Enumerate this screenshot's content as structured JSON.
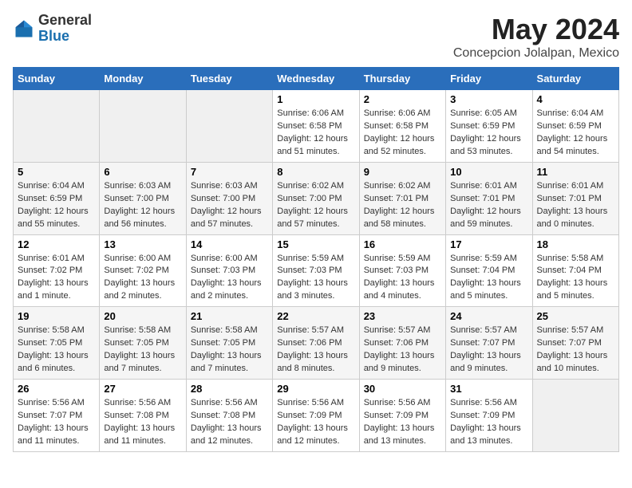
{
  "logo": {
    "general": "General",
    "blue": "Blue"
  },
  "title": "May 2024",
  "subtitle": "Concepcion Jolalpan, Mexico",
  "days_of_week": [
    "Sunday",
    "Monday",
    "Tuesday",
    "Wednesday",
    "Thursday",
    "Friday",
    "Saturday"
  ],
  "weeks": [
    [
      {
        "day": "",
        "info": ""
      },
      {
        "day": "",
        "info": ""
      },
      {
        "day": "",
        "info": ""
      },
      {
        "day": "1",
        "info": "Sunrise: 6:06 AM\nSunset: 6:58 PM\nDaylight: 12 hours\nand 51 minutes."
      },
      {
        "day": "2",
        "info": "Sunrise: 6:06 AM\nSunset: 6:58 PM\nDaylight: 12 hours\nand 52 minutes."
      },
      {
        "day": "3",
        "info": "Sunrise: 6:05 AM\nSunset: 6:59 PM\nDaylight: 12 hours\nand 53 minutes."
      },
      {
        "day": "4",
        "info": "Sunrise: 6:04 AM\nSunset: 6:59 PM\nDaylight: 12 hours\nand 54 minutes."
      }
    ],
    [
      {
        "day": "5",
        "info": "Sunrise: 6:04 AM\nSunset: 6:59 PM\nDaylight: 12 hours\nand 55 minutes."
      },
      {
        "day": "6",
        "info": "Sunrise: 6:03 AM\nSunset: 7:00 PM\nDaylight: 12 hours\nand 56 minutes."
      },
      {
        "day": "7",
        "info": "Sunrise: 6:03 AM\nSunset: 7:00 PM\nDaylight: 12 hours\nand 57 minutes."
      },
      {
        "day": "8",
        "info": "Sunrise: 6:02 AM\nSunset: 7:00 PM\nDaylight: 12 hours\nand 57 minutes."
      },
      {
        "day": "9",
        "info": "Sunrise: 6:02 AM\nSunset: 7:01 PM\nDaylight: 12 hours\nand 58 minutes."
      },
      {
        "day": "10",
        "info": "Sunrise: 6:01 AM\nSunset: 7:01 PM\nDaylight: 12 hours\nand 59 minutes."
      },
      {
        "day": "11",
        "info": "Sunrise: 6:01 AM\nSunset: 7:01 PM\nDaylight: 13 hours\nand 0 minutes."
      }
    ],
    [
      {
        "day": "12",
        "info": "Sunrise: 6:01 AM\nSunset: 7:02 PM\nDaylight: 13 hours\nand 1 minute."
      },
      {
        "day": "13",
        "info": "Sunrise: 6:00 AM\nSunset: 7:02 PM\nDaylight: 13 hours\nand 2 minutes."
      },
      {
        "day": "14",
        "info": "Sunrise: 6:00 AM\nSunset: 7:03 PM\nDaylight: 13 hours\nand 2 minutes."
      },
      {
        "day": "15",
        "info": "Sunrise: 5:59 AM\nSunset: 7:03 PM\nDaylight: 13 hours\nand 3 minutes."
      },
      {
        "day": "16",
        "info": "Sunrise: 5:59 AM\nSunset: 7:03 PM\nDaylight: 13 hours\nand 4 minutes."
      },
      {
        "day": "17",
        "info": "Sunrise: 5:59 AM\nSunset: 7:04 PM\nDaylight: 13 hours\nand 5 minutes."
      },
      {
        "day": "18",
        "info": "Sunrise: 5:58 AM\nSunset: 7:04 PM\nDaylight: 13 hours\nand 5 minutes."
      }
    ],
    [
      {
        "day": "19",
        "info": "Sunrise: 5:58 AM\nSunset: 7:05 PM\nDaylight: 13 hours\nand 6 minutes."
      },
      {
        "day": "20",
        "info": "Sunrise: 5:58 AM\nSunset: 7:05 PM\nDaylight: 13 hours\nand 7 minutes."
      },
      {
        "day": "21",
        "info": "Sunrise: 5:58 AM\nSunset: 7:05 PM\nDaylight: 13 hours\nand 7 minutes."
      },
      {
        "day": "22",
        "info": "Sunrise: 5:57 AM\nSunset: 7:06 PM\nDaylight: 13 hours\nand 8 minutes."
      },
      {
        "day": "23",
        "info": "Sunrise: 5:57 AM\nSunset: 7:06 PM\nDaylight: 13 hours\nand 9 minutes."
      },
      {
        "day": "24",
        "info": "Sunrise: 5:57 AM\nSunset: 7:07 PM\nDaylight: 13 hours\nand 9 minutes."
      },
      {
        "day": "25",
        "info": "Sunrise: 5:57 AM\nSunset: 7:07 PM\nDaylight: 13 hours\nand 10 minutes."
      }
    ],
    [
      {
        "day": "26",
        "info": "Sunrise: 5:56 AM\nSunset: 7:07 PM\nDaylight: 13 hours\nand 11 minutes."
      },
      {
        "day": "27",
        "info": "Sunrise: 5:56 AM\nSunset: 7:08 PM\nDaylight: 13 hours\nand 11 minutes."
      },
      {
        "day": "28",
        "info": "Sunrise: 5:56 AM\nSunset: 7:08 PM\nDaylight: 13 hours\nand 12 minutes."
      },
      {
        "day": "29",
        "info": "Sunrise: 5:56 AM\nSunset: 7:09 PM\nDaylight: 13 hours\nand 12 minutes."
      },
      {
        "day": "30",
        "info": "Sunrise: 5:56 AM\nSunset: 7:09 PM\nDaylight: 13 hours\nand 13 minutes."
      },
      {
        "day": "31",
        "info": "Sunrise: 5:56 AM\nSunset: 7:09 PM\nDaylight: 13 hours\nand 13 minutes."
      },
      {
        "day": "",
        "info": ""
      }
    ]
  ]
}
